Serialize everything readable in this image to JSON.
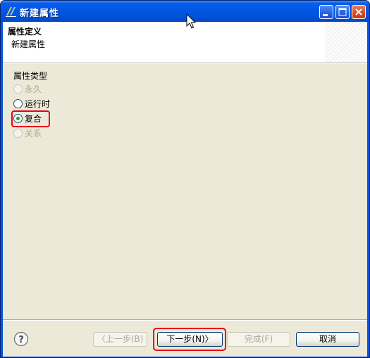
{
  "window": {
    "title": "新建属性"
  },
  "header": {
    "title": "属性定义",
    "subtitle": "新建属性"
  },
  "property_type": {
    "label": "属性类型",
    "options": [
      {
        "label": "永久",
        "enabled": false,
        "checked": false
      },
      {
        "label": "运行时",
        "enabled": true,
        "checked": false
      },
      {
        "label": "复合",
        "enabled": true,
        "checked": true
      },
      {
        "label": "关系",
        "enabled": false,
        "checked": false
      }
    ]
  },
  "footer": {
    "help_icon": "help-icon",
    "back_label": "〈上一步(B)",
    "next_label": "下一步(N)〉",
    "finish_label": "完成(F)",
    "cancel_label": "取消"
  },
  "colors": {
    "title_bar": "#0058e6",
    "dialog_bg": "#ece9d8",
    "highlight": "#e8001c",
    "radio_dot": "#21a121"
  }
}
